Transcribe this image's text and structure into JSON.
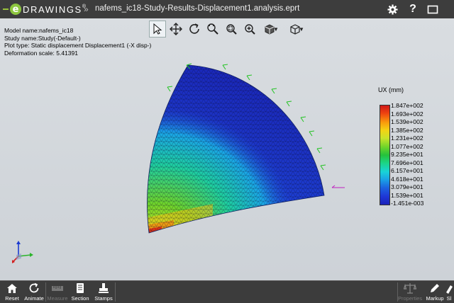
{
  "app": {
    "name": "DRAWINGS",
    "logo_letter": "e",
    "trademark": "®"
  },
  "title": {
    "separator": "»",
    "document": "nafems_ic18-Study-Results-Displacement1.analysis.eprt"
  },
  "titlebar_icons": [
    "gear-icon",
    "help-icon",
    "restore-icon"
  ],
  "titlebar_glyphs": {
    "help": "?"
  },
  "info": {
    "model": "Model name:nafems_ic18",
    "study": "Study name:Study(-Default-)",
    "plot": "Plot type: Static displacement Displacement1 (-X disp-)",
    "scale": "Deformation scale: 5.41391"
  },
  "toolbar": {
    "items": [
      "select-icon",
      "pan-icon",
      "rotate-icon",
      "zoom-fit-icon",
      "zoom-area-icon",
      "zoom-icon",
      "display-style-icon",
      "view-orientation-icon"
    ]
  },
  "legend": {
    "title": "UX (mm)",
    "values": [
      "1.847e+002",
      "1.693e+002",
      "1.539e+002",
      "1.385e+002",
      "1.231e+002",
      "1.077e+002",
      "9.235e+001",
      "7.696e+001",
      "6.157e+001",
      "4.618e+001",
      "3.079e+001",
      "1.539e+001",
      "-1.451e-003"
    ],
    "colors": [
      "#d01818",
      "#1a22b8"
    ]
  },
  "bottom": {
    "reset": "Reset",
    "animate": "Animate",
    "measure": "Measure",
    "section": "Section",
    "stamps": "Stamps",
    "properties": "Properties",
    "markup": "Markup",
    "more": "Sl"
  }
}
